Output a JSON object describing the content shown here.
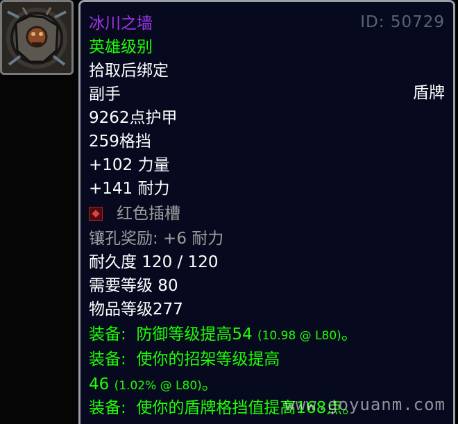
{
  "icon": {
    "semantic": "shield-item-icon"
  },
  "item": {
    "name": "冰川之墙",
    "id_label": "ID: 50729",
    "quality": "英雄级别",
    "binding": "拾取后绑定",
    "slot": "副手",
    "type": "盾牌",
    "armor": "9262点护甲",
    "block": "259格挡",
    "strength": "+102 力量",
    "stamina": "+141 耐力",
    "socket": "红色插槽",
    "socket_bonus": "镶孔奖励: +6 耐力",
    "durability": "耐久度 120 / 120",
    "required_level": "需要等级 80",
    "item_level": "物品等级277",
    "equip1_prefix": "装备:",
    "equip1_text": "防御等级提高54",
    "equip1_detail": "(10.98 @ L80)",
    "equip1_end": "。",
    "equip2_prefix": "装备:",
    "equip2_text": "使你的招架等级提高",
    "equip2_value": "46",
    "equip2_detail": "(1.02% @ L80)",
    "equip2_end": "。",
    "equip3_prefix": "装备:",
    "equip3_text": "使你的盾牌格挡值提高168点。"
  },
  "watermark": "www.goyuanm.com",
  "colors": {
    "epic": "#a335ee",
    "uncommon": "#1eff00",
    "gray": "#9d9d9d",
    "background": "#070a1f",
    "border": "#9aa0a8"
  }
}
